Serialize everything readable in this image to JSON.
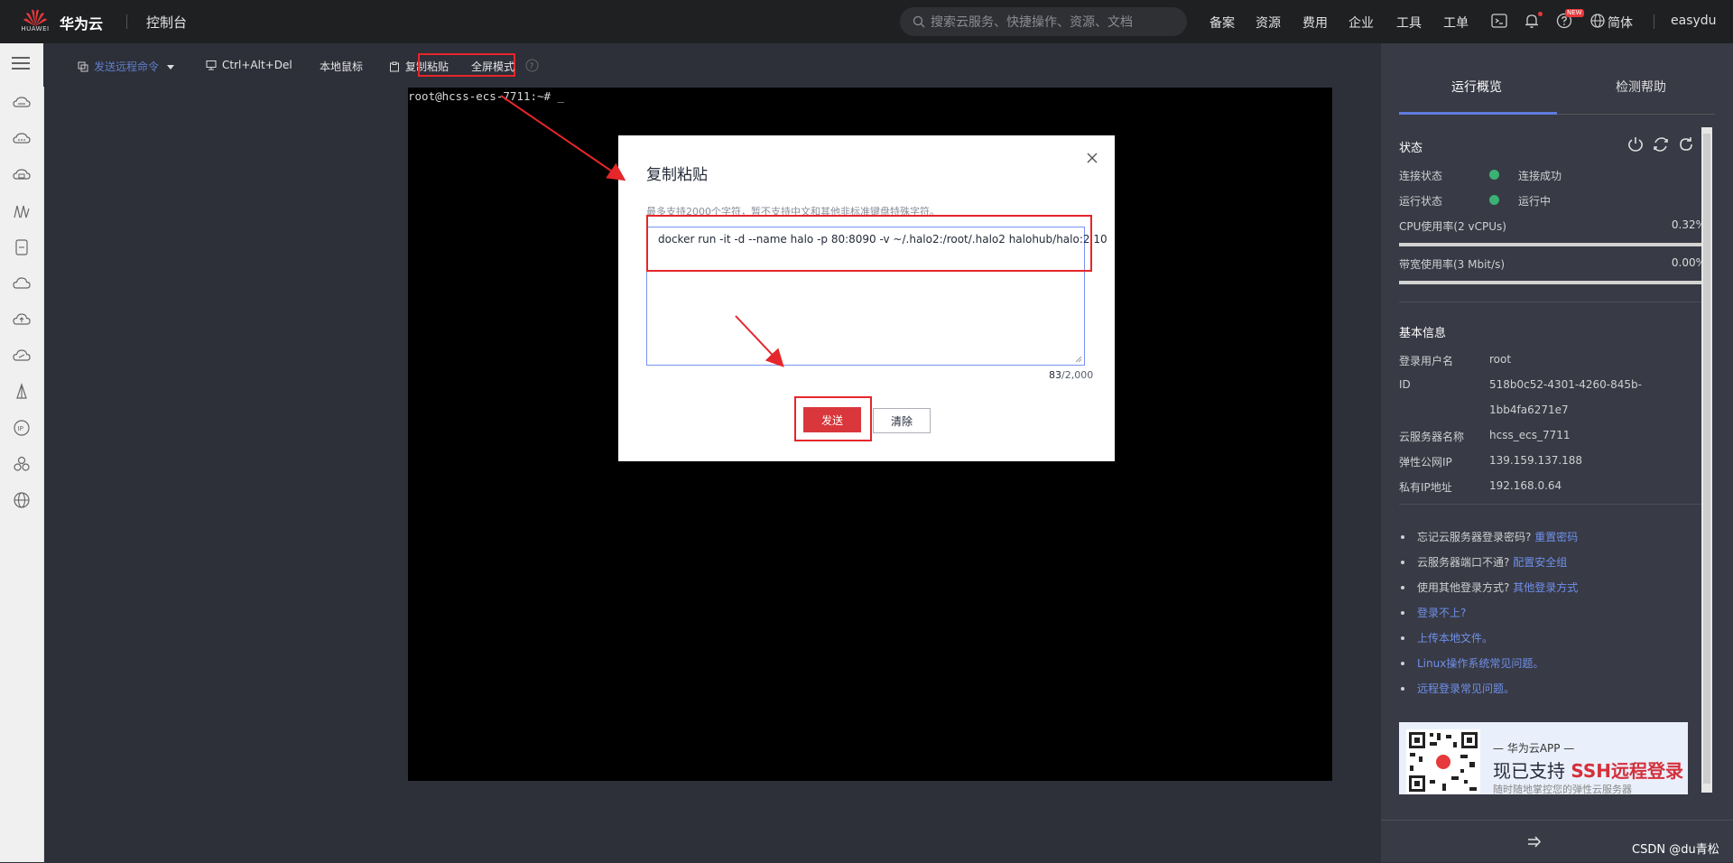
{
  "topbar": {
    "brand": "华为云",
    "logo_text": "HUAWEI",
    "console": "控制台",
    "search_placeholder": "搜索云服务、快捷操作、资源、文档",
    "nav": [
      "备案",
      "资源",
      "费用",
      "企业",
      "工具",
      "工单"
    ],
    "new_badge": "NEW",
    "language": "简体",
    "user": "easydu"
  },
  "toolbar": {
    "send_remote": "发送远程命令",
    "ctrl_alt_del": "Ctrl+Alt+Del",
    "local_mouse": "本地鼠标",
    "copy_paste": "复制粘贴",
    "fullscreen": "全屏模式"
  },
  "terminal": {
    "prompt": "root@hcss-ecs-7711:~# _"
  },
  "modal": {
    "title": "复制粘贴",
    "tip": "最多支持2000个字符，暂不支持中文和其他非标准键盘特殊字符。",
    "text": "docker run -it -d --name halo -p 80:8090 -v ~/.halo2:/root/.halo2 halohub/halo:2.10",
    "count": "83",
    "max": "/2,000",
    "send": "发送",
    "clear": "清除"
  },
  "right_panel": {
    "tabs": [
      "运行概览",
      "检测帮助"
    ],
    "status": {
      "title": "状态",
      "conn_label": "连接状态",
      "conn_value": "连接成功",
      "run_label": "运行状态",
      "run_value": "运行中",
      "cpu_label": "CPU使用率(2 vCPUs)",
      "cpu_value": "0.32%",
      "cpu_fraction": 0.0032,
      "bw_label": "带宽使用率(3 Mbit/s)",
      "bw_value": "0.00%",
      "bw_fraction": 0
    },
    "basic": {
      "title": "基本信息",
      "user_label": "登录用户名",
      "user_value": "root",
      "id_label": "ID",
      "id_value_1": "518b0c52-4301-4260-845b-",
      "id_value_2": "1bb4fa6271e7",
      "name_label": "云服务器名称",
      "name_value": "hcss_ecs_7711",
      "eip_label": "弹性公网IP",
      "eip_value": "139.159.137.188",
      "pip_label": "私有IP地址",
      "pip_value": "192.168.0.64"
    },
    "help": [
      {
        "text": "忘记云服务器登录密码?",
        "link": "重置密码"
      },
      {
        "text": "云服务器端口不通?",
        "link": "配置安全组"
      },
      {
        "text": "使用其他登录方式?",
        "link": "其他登录方式"
      },
      {
        "text": "",
        "link": "登录不上?"
      },
      {
        "text": "",
        "link": "上传本地文件。"
      },
      {
        "text": "",
        "link": "Linux操作系统常见问题。"
      },
      {
        "text": "",
        "link": "远程登录常见问题。"
      }
    ],
    "banner": {
      "line1": "— 华为云APP —",
      "line2_a": "现已支持 ",
      "line2_b": "SSH远程登录",
      "line3": "随时随地掌控您的弹性云服务器"
    }
  },
  "watermark": "CSDN @du青松",
  "colors": {
    "accent_red": "#e5262b",
    "link_blue": "#6f90ea",
    "success_green": "#3ab273"
  }
}
